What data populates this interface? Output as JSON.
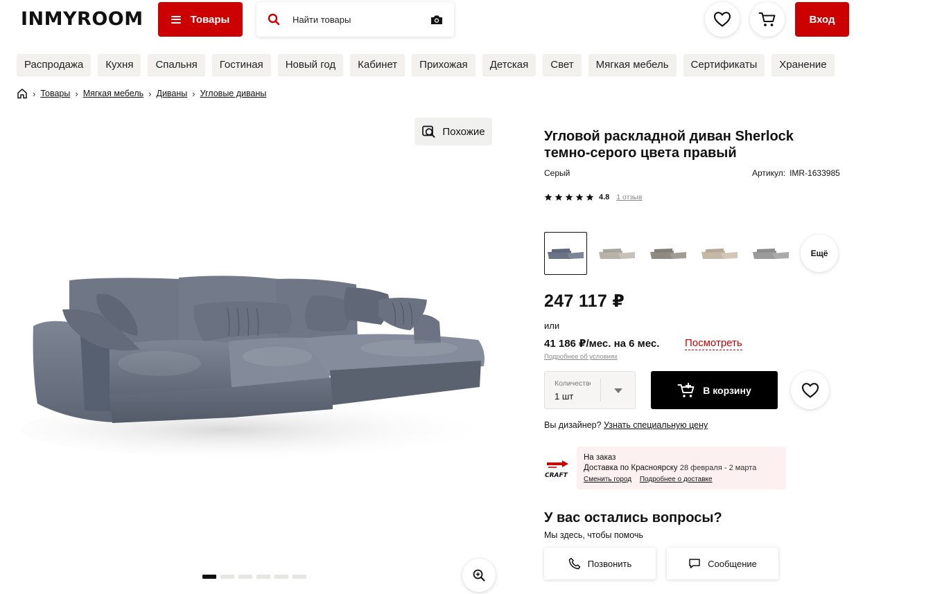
{
  "header": {
    "logo": "INMYROOM",
    "catalog_label": "Товары",
    "search_placeholder": "Найти товары",
    "login_label": "Вход",
    "brand_color": "#cc0000"
  },
  "categories": [
    "Распродажа",
    "Кухня",
    "Спальня",
    "Гостиная",
    "Новый год",
    "Кабинет",
    "Прихожая",
    "Детская",
    "Свет",
    "Мягкая мебель",
    "Сертификаты",
    "Хранение"
  ],
  "breadcrumbs": [
    "Товары",
    "Мягкая мебель",
    "Диваны",
    "Угловые диваны"
  ],
  "gallery": {
    "similar_label": "Похожие",
    "slide_count": 6,
    "active_slide": 1
  },
  "product": {
    "title": "Угловой раскладной диван Sherlock темно-серого цвета правый",
    "color": "Серый",
    "article_label": "Артикул:",
    "article": "IMR-1633985",
    "rating": "4.8",
    "reviews_link": "1 отзыв",
    "more_variants_label": "Ещё",
    "price": "247 117 ₽",
    "or_label": "или",
    "installment": "41 186 ₽/мес. на 6 мес.",
    "view_label": "Посмотреть",
    "conditions_link": "Подробнее об условиях",
    "quantity_label": "Количество",
    "quantity_value": "1 шт",
    "add_to_cart": "В корзину",
    "designer_question": "Вы дизайнер?",
    "designer_link": "Узнать специальную цену"
  },
  "delivery": {
    "craft_logo_text": "CRAFT",
    "status": "На заказ",
    "text": "Доставка по Красноярску",
    "dates": "28 февраля - 2 марта",
    "change_city": "Сменить город",
    "details": "Подробнее о доставке"
  },
  "questions": {
    "title": "У вас остались вопросы?",
    "subtitle": "Мы здесь, чтобы помочь",
    "call_label": "Позвонить",
    "message_label": "Сообщение"
  }
}
